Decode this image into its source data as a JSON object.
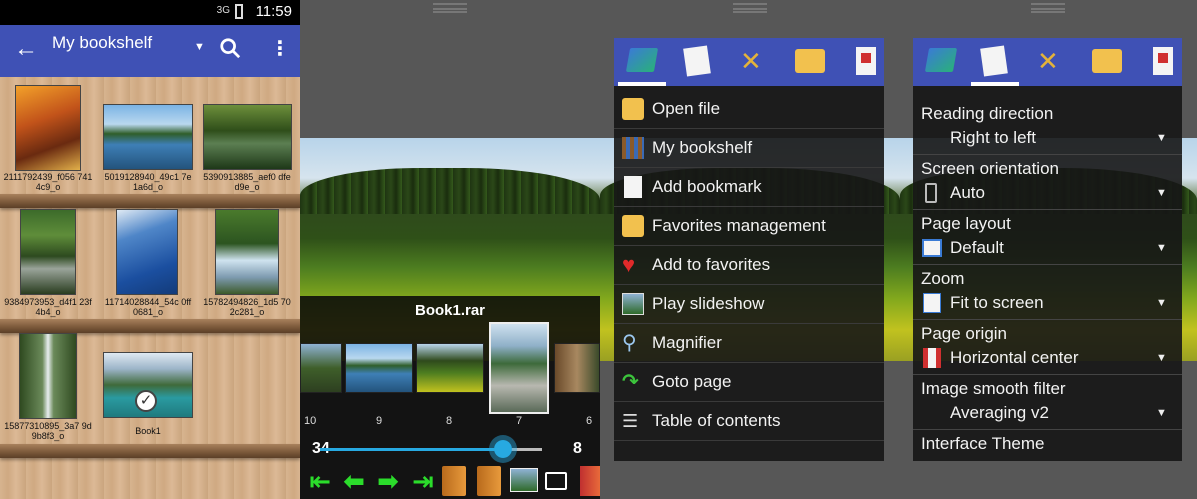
{
  "status": {
    "signal": "3G",
    "time": "11:59"
  },
  "appbar": {
    "title": "My bookshelf"
  },
  "books": [
    "2111792439_f056 7414c9_o",
    "5019128940_49c1 7e1a6d_o",
    "5390913885_aef0 dfed9e_o",
    "9384973953_d4f1 23f4b4_o",
    "11714028844_54c 0ff0681_o",
    "15782494826_1d5 702c281_o",
    "15877310895_3a7 9d9b8f3_o",
    "Book1"
  ],
  "viewer": {
    "book_title": "Book1.rar",
    "strip_pages": [
      "10",
      "9",
      "8",
      "7",
      "6"
    ],
    "total_pages": "34",
    "current_page": "8"
  },
  "menu": {
    "items": [
      "Open file",
      "My bookshelf",
      "Add bookmark",
      "Favorites management",
      "Add to favorites",
      "Play slideshow",
      "Magnifier",
      "Goto page",
      "Table of contents"
    ]
  },
  "settings": [
    {
      "label": "Reading direction",
      "value": "Right to left"
    },
    {
      "label": "Screen orientation",
      "value": "Auto"
    },
    {
      "label": "Page layout",
      "value": "Default"
    },
    {
      "label": "Zoom",
      "value": "Fit to screen"
    },
    {
      "label": "Page origin",
      "value": "Horizontal center"
    },
    {
      "label": "Image smooth filter",
      "value": "Averaging v2"
    },
    {
      "label": "Interface Theme"
    }
  ],
  "colors": {
    "accent": "#3f51b5",
    "slider": "#27a9e1",
    "nav_arrows": "#2bdc2b"
  },
  "slider": {
    "position_fraction": 0.82
  }
}
